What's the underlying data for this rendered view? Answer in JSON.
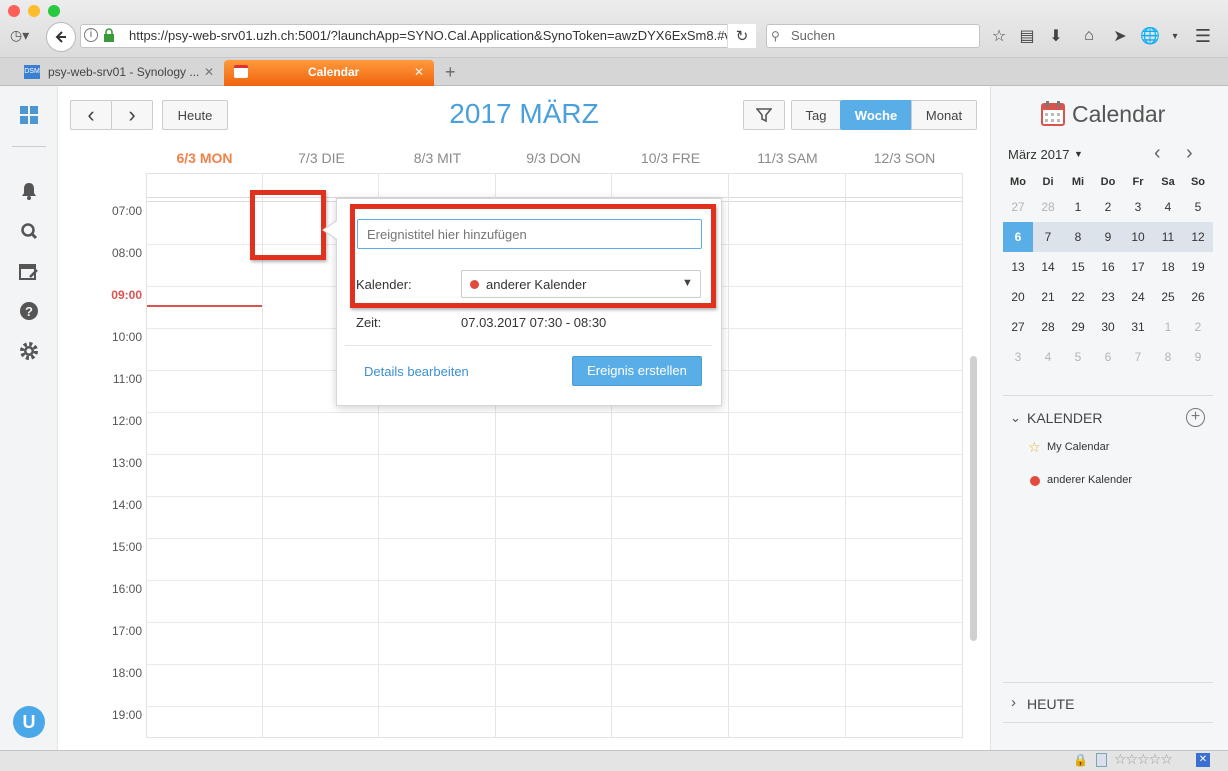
{
  "browser": {
    "url": "https://psy-web-srv01.uzh.ch:5001/?launchApp=SYNO.Cal.Application&SynoToken=awzDYX6ExSm8.#v",
    "search_placeholder": "Suchen",
    "tabs": [
      {
        "title": "psy-web-srv01 - Synology ...",
        "favicon": "DSM"
      },
      {
        "title": "Calendar"
      }
    ]
  },
  "toolbar": {
    "prev": "‹",
    "next": "›",
    "today": "Heute",
    "title": "2017 MÄRZ",
    "filter_icon": "filter-icon",
    "views": [
      "Tag",
      "Woche",
      "Monat"
    ],
    "active_view": "Woche"
  },
  "week": {
    "days": [
      "6/3 MON",
      "7/3 DIE",
      "8/3 MIT",
      "9/3 DON",
      "10/3 FRE",
      "11/3 SAM",
      "12/3 SON"
    ],
    "today_index": 0,
    "hours": [
      "07:00",
      "08:00",
      "09:00",
      "10:00",
      "11:00",
      "12:00",
      "13:00",
      "14:00",
      "15:00",
      "16:00",
      "17:00",
      "18:00",
      "19:00"
    ],
    "current_hour": "09:00"
  },
  "popup": {
    "title_placeholder": "Ereignistitel hier hinzufügen",
    "calendar_label": "Kalender:",
    "calendar_value": "anderer Kalender",
    "time_label": "Zeit:",
    "time_value": "07.03.2017 07:30 - 08:30",
    "details_link": "Details bearbeiten",
    "create_button": "Ereignis erstellen"
  },
  "sidebar": {
    "app_title": "Calendar",
    "mini_month": "März 2017",
    "weekdays": [
      "Mo",
      "Di",
      "Mi",
      "Do",
      "Fr",
      "Sa",
      "So"
    ],
    "weeks": [
      [
        "27",
        "28",
        "1",
        "2",
        "3",
        "4",
        "5"
      ],
      [
        "6",
        "7",
        "8",
        "9",
        "10",
        "11",
        "12"
      ],
      [
        "13",
        "14",
        "15",
        "16",
        "17",
        "18",
        "19"
      ],
      [
        "20",
        "21",
        "22",
        "23",
        "24",
        "25",
        "26"
      ],
      [
        "27",
        "28",
        "29",
        "30",
        "31",
        "1",
        "2"
      ],
      [
        "3",
        "4",
        "5",
        "6",
        "7",
        "8",
        "9"
      ]
    ],
    "selected_day": "6",
    "calendars_section": "KALENDER",
    "calendars": [
      {
        "name": "My Calendar",
        "icon": "star-icon",
        "color": "#e0b22a"
      },
      {
        "name": "anderer Kalender",
        "icon": "dot-icon",
        "color": "#e04a3f"
      }
    ],
    "today_section": "HEUTE"
  },
  "user": {
    "avatar_letter": "U"
  },
  "colors": {
    "accent": "#5aaee8",
    "today": "#f0814a",
    "now_line": "#d9534f",
    "highlight_box": "#e0301e"
  }
}
